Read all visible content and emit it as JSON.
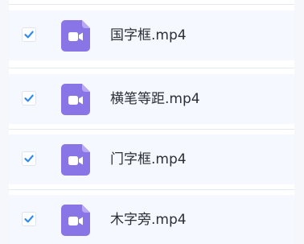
{
  "files": [
    {
      "name": "国字框.mp4",
      "checked": true
    },
    {
      "name": "横笔等距.mp4",
      "checked": true
    },
    {
      "name": "门字框.mp4",
      "checked": true
    },
    {
      "name": "木字旁.mp4",
      "checked": true
    }
  ],
  "colors": {
    "checkmark": "#2f8bf1",
    "video_icon": "#8a75e6",
    "video_icon_fold": "#b9a9f5",
    "row_background": "#f5f8fe"
  },
  "icons": {
    "checkbox": "check-icon",
    "file_type": "video-file-icon"
  }
}
